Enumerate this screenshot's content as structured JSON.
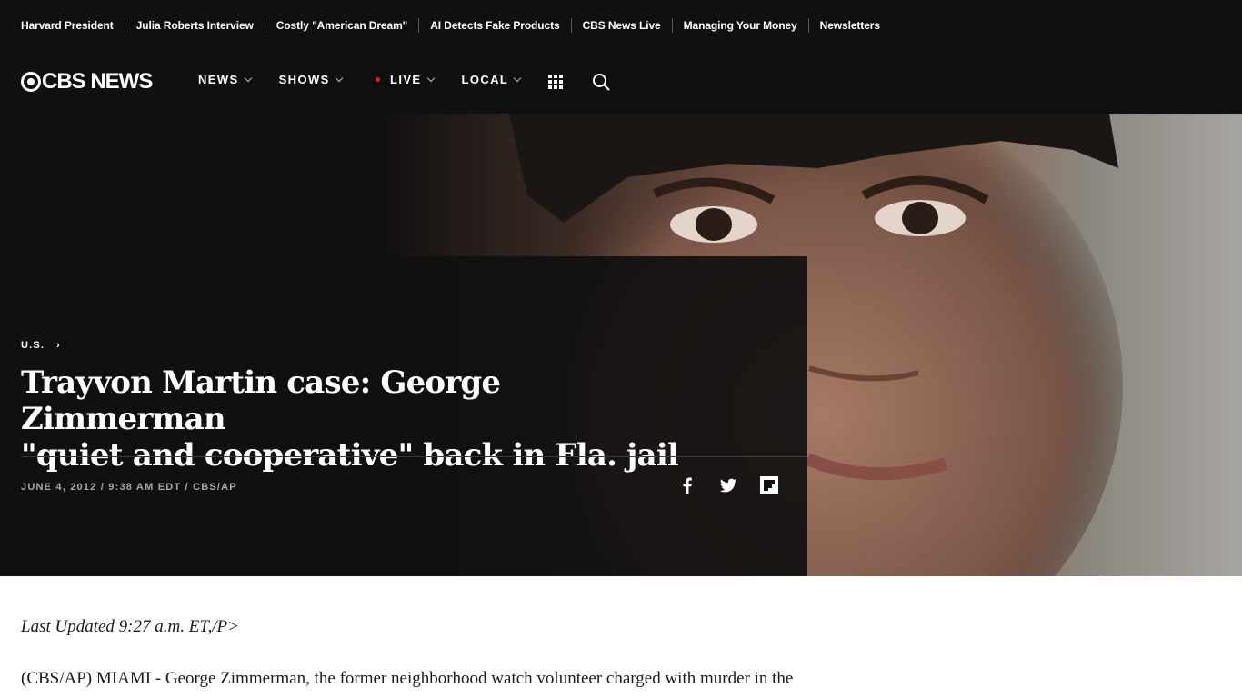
{
  "trending": [
    {
      "label": "Harvard President"
    },
    {
      "label": "Julia Roberts Interview"
    },
    {
      "label": "Costly \"American Dream\""
    },
    {
      "label": "AI Detects Fake Products"
    },
    {
      "label": "CBS News Live"
    },
    {
      "label": "Managing Your Money"
    },
    {
      "label": "Newsletters"
    }
  ],
  "logo": {
    "text": "CBS NEWS",
    "icon": "cbs-eye-logo"
  },
  "nav": {
    "news": "NEWS",
    "shows": "SHOWS",
    "live": "LIVE",
    "local": "LOCAL",
    "live_dot_color": "#e01e1e",
    "icons": [
      "grid-menu-icon",
      "search-icon",
      "chevron-down-icon"
    ]
  },
  "hero": {
    "section": "U.S.",
    "headline_line1": "Trayvon Martin case: George Zimmerman",
    "headline_line2": "\"quiet and cooperative\" back in Fla. jail",
    "byline": "JUNE 4, 2012 / 9:38 AM EDT / CBS/AP",
    "share_icons": [
      "facebook-icon",
      "twitter-icon",
      "flipboard-icon"
    ]
  },
  "article": {
    "updated": "Last Updated 9:27 a.m. ET,/P>",
    "paragraph1": "(CBS/AP) MIAMI - George Zimmerman, the former neighborhood watch volunteer charged with murder in the"
  },
  "colors": {
    "header_bg": "#101010",
    "hero_panel_bg": "#101010",
    "byline_gray": "#a8a8a8",
    "body_text": "#1b1b1b"
  }
}
